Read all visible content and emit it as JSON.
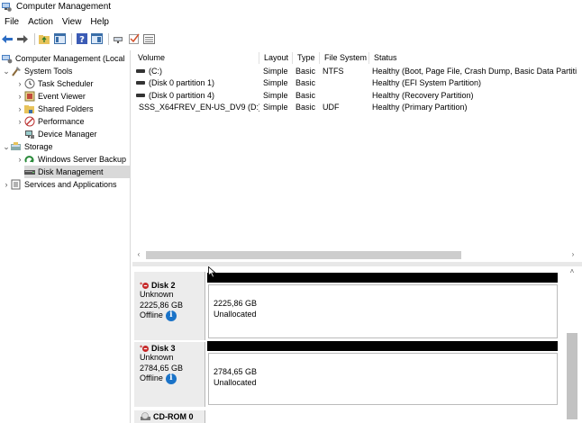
{
  "window": {
    "title": "Computer Management"
  },
  "menu": [
    "File",
    "Action",
    "View",
    "Help"
  ],
  "toolbar": {
    "icons": [
      "back-arrow-icon",
      "forward-arrow-icon",
      "up-folder-icon",
      "show-hide-tree-icon",
      "help-icon",
      "properties-icon",
      "connect-icon",
      "check-icon",
      "export-list-icon"
    ]
  },
  "tree": {
    "root": "Computer Management (Local",
    "system_tools": "System Tools",
    "task_scheduler": "Task Scheduler",
    "event_viewer": "Event Viewer",
    "shared_folders": "Shared Folders",
    "performance": "Performance",
    "device_manager": "Device Manager",
    "storage": "Storage",
    "windows_server_backup": "Windows Server Backup",
    "disk_management": "Disk Management",
    "services_apps": "Services and Applications"
  },
  "volumes": {
    "headers": [
      "Volume",
      "Layout",
      "Type",
      "File System",
      "Status"
    ],
    "rows": [
      {
        "volume": "(C:)",
        "layout": "Simple",
        "type": "Basic",
        "fs": "NTFS",
        "status": "Healthy (Boot, Page File, Crash Dump, Basic Data Partiti"
      },
      {
        "volume": "(Disk 0 partition 1)",
        "layout": "Simple",
        "type": "Basic",
        "fs": "",
        "status": "Healthy (EFI System Partition)"
      },
      {
        "volume": "(Disk 0 partition 4)",
        "layout": "Simple",
        "type": "Basic",
        "fs": "",
        "status": "Healthy (Recovery Partition)"
      },
      {
        "volume": "SSS_X64FREV_EN-US_DV9 (D:)",
        "layout": "Simple",
        "type": "Basic",
        "fs": "UDF",
        "status": "Healthy (Primary Partition)"
      }
    ]
  },
  "disks": [
    {
      "name": "Disk 2",
      "kind": "Unknown",
      "size": "2225,86 GB",
      "state": "Offline",
      "part_size": "2225,86 GB",
      "part_label": "Unallocated"
    },
    {
      "name": "Disk 3",
      "kind": "Unknown",
      "size": "2784,65 GB",
      "state": "Offline",
      "part_size": "2784,65 GB",
      "part_label": "Unallocated"
    }
  ],
  "cdrom": {
    "name": "CD-ROM 0"
  },
  "colors": {
    "selection": "#d9d9d9",
    "info_blue": "#1a73c8",
    "offline_red": "#c62828",
    "disk_bar": "#000000"
  }
}
